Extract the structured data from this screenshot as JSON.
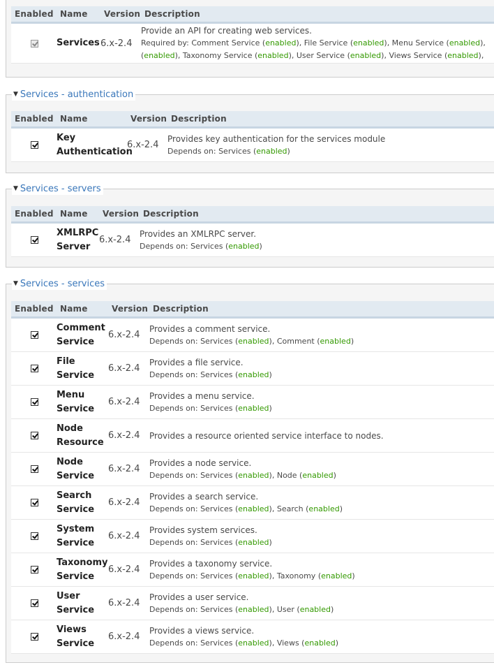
{
  "columns": {
    "enabled": "Enabled",
    "name": "Name",
    "version": "Version",
    "description": "Description"
  },
  "colors": {
    "legend": "#3a77ba",
    "enabled_status": "#339900",
    "header_bg": "#e2eaf1"
  },
  "core": {
    "rows": [
      {
        "name": "Services",
        "version": "6.x-2.4",
        "description": "Provide an API for creating web services.",
        "required_by_line1": "Required by: Comment Service (enabled), File Service (enabled), Menu Service (enabled),",
        "required_by_line2": "(enabled), Taxonomy Service (enabled), User Service (enabled), Views Service (enabled),",
        "checked": true,
        "disabled": true
      }
    ]
  },
  "groups": [
    {
      "legend": "Services - authentication",
      "rows": [
        {
          "name_l1": "Key",
          "name_l2": "Authentication",
          "version": "6.x-2.4",
          "description": "Provides key authentication for the services module",
          "deps_label": "Depends on: Services",
          "deps_status": "enabled",
          "checked": true
        }
      ]
    },
    {
      "legend": "Services - servers",
      "rows": [
        {
          "name_l1": "XMLRPC",
          "name_l2": "Server",
          "version": "6.x-2.4",
          "description": "Provides an XMLRPC server.",
          "deps_label": "Depends on: Services",
          "deps_status": "enabled",
          "checked": true
        }
      ]
    },
    {
      "legend": "Services - services",
      "rows": [
        {
          "name_l1": "Comment",
          "name_l2": "Service",
          "version": "6.x-2.4",
          "description": "Provides a comment service.",
          "deps": "Depends on: Services (enabled), Comment (enabled)",
          "checked": true
        },
        {
          "name_l1": "File",
          "name_l2": "Service",
          "version": "6.x-2.4",
          "description": "Provides a file service.",
          "deps": "Depends on: Services (enabled)",
          "checked": true
        },
        {
          "name_l1": "Menu",
          "name_l2": "Service",
          "version": "6.x-2.4",
          "description": "Provides a menu service.",
          "deps": "Depends on: Services (enabled)",
          "checked": true
        },
        {
          "name_l1": "Node",
          "name_l2": "Resource",
          "version": "6.x-2.4",
          "description": "Provides a resource oriented service interface to nodes.",
          "deps": "",
          "checked": true
        },
        {
          "name_l1": "Node",
          "name_l2": "Service",
          "version": "6.x-2.4",
          "description": "Provides a node service.",
          "deps": "Depends on: Services (enabled), Node (enabled)",
          "checked": true
        },
        {
          "name_l1": "Search",
          "name_l2": "Service",
          "version": "6.x-2.4",
          "description": "Provides a search service.",
          "deps": "Depends on: Services (enabled), Search (enabled)",
          "checked": true
        },
        {
          "name_l1": "System",
          "name_l2": "Service",
          "version": "6.x-2.4",
          "description": "Provides system services.",
          "deps": "Depends on: Services (enabled)",
          "checked": true
        },
        {
          "name_l1": "Taxonomy",
          "name_l2": "Service",
          "version": "6.x-2.4",
          "description": "Provides a taxonomy service.",
          "deps": "Depends on: Services (enabled), Taxonomy (enabled)",
          "checked": true
        },
        {
          "name_l1": "User",
          "name_l2": "Service",
          "version": "6.x-2.4",
          "description": "Provides a user service.",
          "deps": "Depends on: Services (enabled), User (enabled)",
          "checked": true
        },
        {
          "name_l1": "Views",
          "name_l2": "Service",
          "version": "6.x-2.4",
          "description": "Provides a views service.",
          "deps": "Depends on: Services (enabled), Views (enabled)",
          "checked": true
        }
      ]
    }
  ]
}
